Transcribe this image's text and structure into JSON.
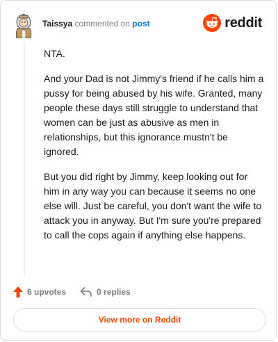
{
  "comment": {
    "author": "Taissya",
    "action_text": "commented on",
    "post_link": "post",
    "paragraphs": [
      "NTA.",
      "And your Dad is not Jimmy's friend if he calls him a pussy for being abused by his wife. Granted, many people these days still struggle to understand that women can be just as abusive as men in relationships, but this ignorance mustn't be ignored.",
      "But you did right by Jimmy, keep looking out for him in any way you can because it seems no one else will. Just be careful, you don't want the wife to attack you in anyway. But I'm sure you're prepared to call the cops again if anything else happens."
    ]
  },
  "brand": {
    "name": "reddit",
    "icon": "reddit-logo-icon",
    "color": "#ff4500"
  },
  "actions": {
    "upvotes": "6 upvotes",
    "replies": "0 replies"
  },
  "footer": {
    "view_more_label": "View more on Reddit"
  },
  "colors": {
    "accent": "#ff4500",
    "link": "#0079d3",
    "muted": "#7c7c7c"
  }
}
